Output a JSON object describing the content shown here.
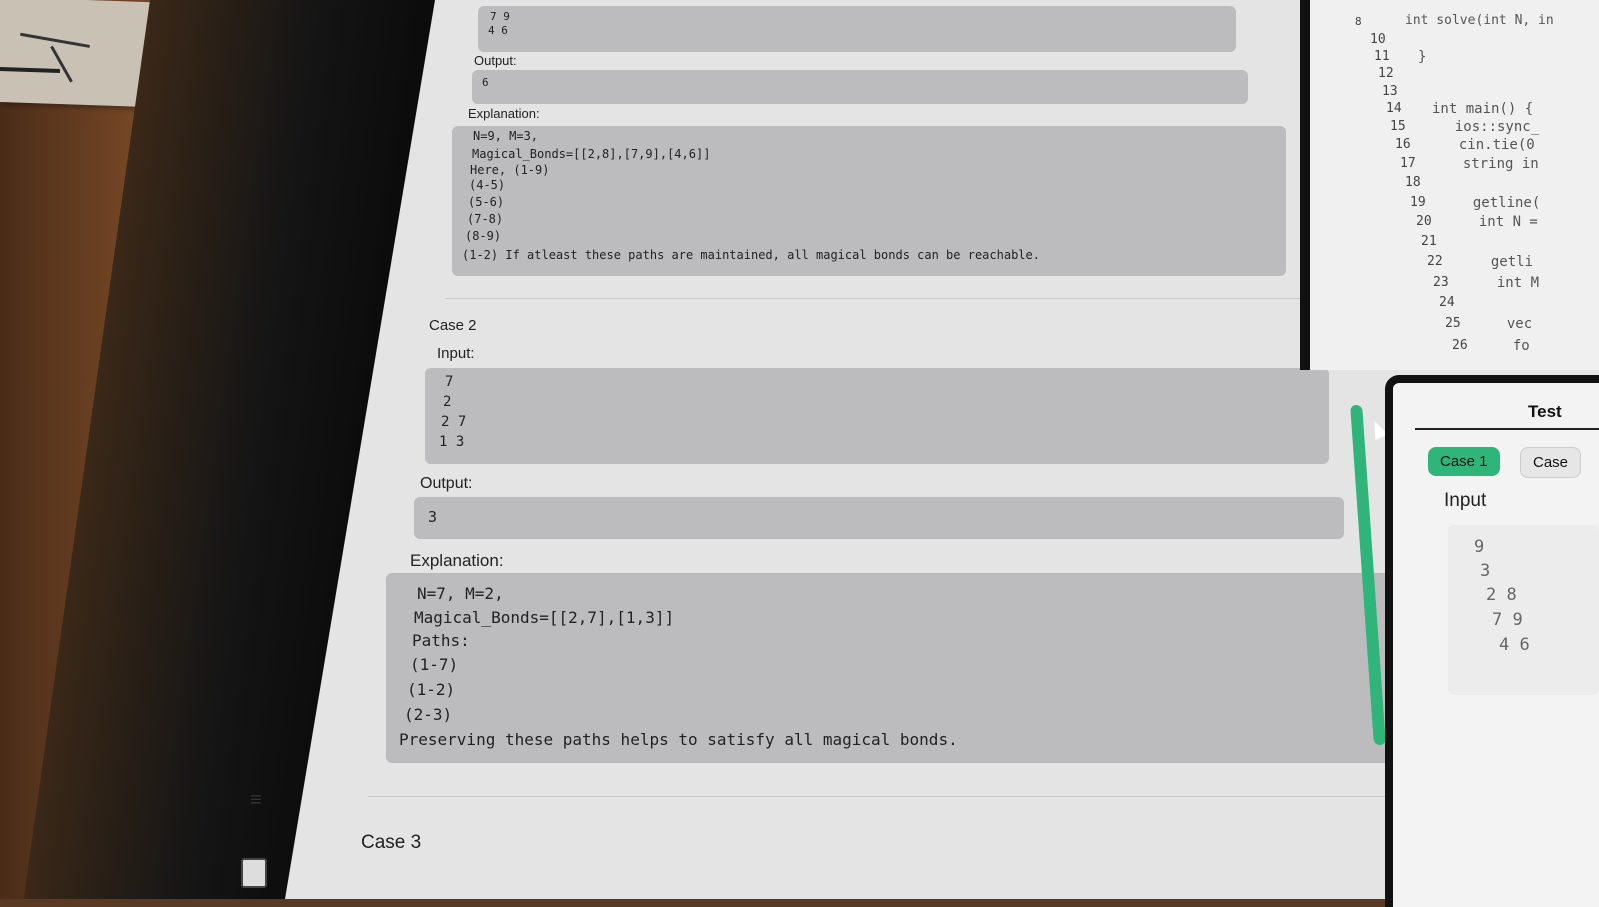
{
  "top_block": {
    "lines": [
      "7 9",
      "4 6"
    ]
  },
  "case1": {
    "output_label": "Output:",
    "output_value": "6",
    "explanation_label": "Explanation:",
    "explanation_lines": [
      "N=9, M=3,",
      "Magical_Bonds=[[2,8],[7,9],[4,6]]",
      "Here, (1-9)",
      "(4-5)",
      "(5-6)",
      "(7-8)",
      "(8-9)",
      "(1-2) If atleast these paths are maintained, all magical bonds can be reachable."
    ]
  },
  "case2": {
    "title": "Case 2",
    "input_label": "Input:",
    "input_lines": [
      "7",
      "2",
      "2 7",
      "1 3"
    ],
    "output_label": "Output:",
    "output_value": "3",
    "explanation_label": "Explanation:",
    "explanation_lines": [
      "N=7, M=2,",
      "Magical_Bonds=[[2,7],[1,3]]",
      "Paths:",
      "(1-7)",
      "(1-2)",
      "(2-3)",
      "Preserving these paths helps to satisfy all magical bonds."
    ]
  },
  "case3": {
    "title": "Case 3"
  },
  "code": {
    "line_numbers": [
      "8",
      "10",
      "11",
      "12",
      "13",
      "14",
      "15",
      "16",
      "17",
      "18",
      "19",
      "20",
      "21",
      "22",
      "23",
      "24",
      "25",
      "26"
    ],
    "lines": [
      "int solve(int N, in",
      "",
      "}",
      "",
      "",
      "int main() {",
      "  ios::sync_",
      "  cin.tie(0",
      "  string in",
      "",
      "  getline(",
      "  int N =",
      "",
      "  getli",
      "  int M",
      "",
      "  vec",
      "  fo"
    ]
  },
  "test_panel": {
    "tab_label": "Test",
    "case1_chip": "Case 1",
    "case2_chip": "Case",
    "input_label": "Input",
    "input_values": [
      "9",
      "3",
      "2 8",
      "7 9",
      "4 6"
    ]
  },
  "colors": {
    "accent": "#2fb57a",
    "block_bg": "#bcbcbe"
  }
}
